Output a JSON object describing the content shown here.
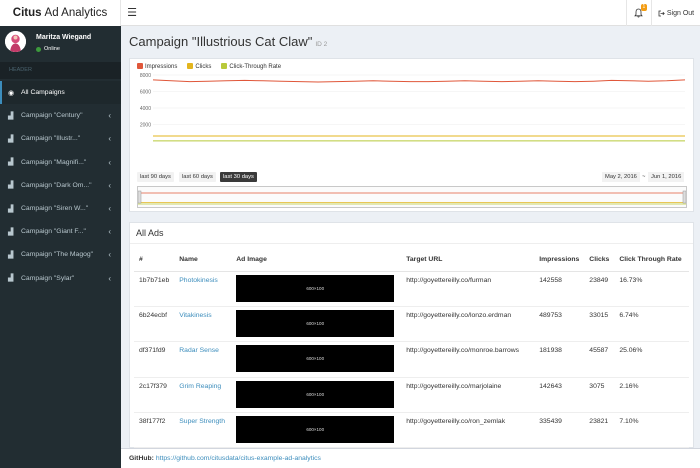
{
  "app": {
    "logo_bold": "Citus",
    "logo_light": "Ad Analytics",
    "menu_toggle_icon": "hamburger-icon",
    "notifications_count": "1",
    "signout_label": "Sign Out"
  },
  "user": {
    "name": "Maritza Wiegand",
    "status": "Online"
  },
  "sidebar": {
    "header": "HEADER",
    "items": [
      {
        "label": "All Campaigns",
        "icon": "circle-icon",
        "active": true
      },
      {
        "label": "Campaign \"Century\"",
        "icon": "bar-chart-icon"
      },
      {
        "label": "Campaign \"Illustr...\"",
        "icon": "bar-chart-icon"
      },
      {
        "label": "Campaign \"Magnifi...\"",
        "icon": "bar-chart-icon"
      },
      {
        "label": "Campaign \"Dark Om...\"",
        "icon": "bar-chart-icon"
      },
      {
        "label": "Campaign \"Siren W...\"",
        "icon": "bar-chart-icon"
      },
      {
        "label": "Campaign \"Giant F...\"",
        "icon": "bar-chart-icon"
      },
      {
        "label": "Campaign \"The Magog\"",
        "icon": "bar-chart-icon"
      },
      {
        "label": "Campaign \"Sylar\"",
        "icon": "bar-chart-icon"
      }
    ]
  },
  "main": {
    "title": "Campaign \"Illustrious Cat Claw\"",
    "title_id": "ID 2",
    "range_buttons": [
      "last 90 days",
      "last 60 days",
      "last 30 days"
    ],
    "range_selected": 2,
    "date_from": "May 2, 2016",
    "date_sep": "~",
    "date_to": "Jun 1, 2016"
  },
  "chart_data": {
    "type": "line",
    "legend": [
      {
        "name": "Impressions",
        "color": "#e0573a"
      },
      {
        "name": "Clicks",
        "color": "#e3b51e"
      },
      {
        "name": "Click-Through Rate",
        "color": "#b8c93a"
      }
    ],
    "y_ticks": [
      "8000",
      "6000",
      "4000",
      "2000"
    ],
    "ylim": [
      0,
      8000
    ],
    "series": [
      {
        "name": "Impressions",
        "values": [
          7400,
          7300,
          7200,
          7250,
          7300,
          7350,
          7300,
          7250,
          7200,
          7150,
          7200,
          7250,
          7300,
          7250,
          7200,
          7200,
          7250,
          7300,
          7250,
          7200,
          7250,
          7300,
          7250,
          7200,
          7250,
          7350,
          7300,
          7250,
          7300,
          7400
        ]
      },
      {
        "name": "Clicks",
        "values": [
          600,
          600,
          600,
          600,
          600,
          600,
          600,
          600,
          600,
          600,
          600,
          600,
          600,
          600,
          600,
          600,
          600,
          600,
          600,
          600,
          600,
          600,
          600,
          600,
          600,
          600,
          600,
          600,
          600,
          600
        ]
      },
      {
        "name": "Click-Through Rate",
        "values": [
          10,
          10,
          10,
          10,
          10,
          10,
          10,
          10,
          10,
          10,
          10,
          10,
          10,
          10,
          10,
          10,
          10,
          10,
          10,
          10,
          10,
          10,
          10,
          10,
          10,
          10,
          10,
          10,
          10,
          10
        ]
      }
    ]
  },
  "ads": {
    "title": "All Ads",
    "columns": [
      "#",
      "Name",
      "Ad Image",
      "Target URL",
      "Impressions",
      "Clicks",
      "Click Through Rate"
    ],
    "image_placeholder": "600×100",
    "rows": [
      {
        "id": "1b7b71eb",
        "name": "Photokinesis",
        "url": "http://goyettereilly.co/furman",
        "impressions": "142558",
        "clicks": "23849",
        "ctr": "16.73%"
      },
      {
        "id": "6b24ecbf",
        "name": "Vitakinesis",
        "url": "http://goyettereilly.co/lonzo.erdman",
        "impressions": "489753",
        "clicks": "33015",
        "ctr": "6.74%"
      },
      {
        "id": "df371fd9",
        "name": "Radar Sense",
        "url": "http://goyettereilly.co/monroe.barrows",
        "impressions": "181938",
        "clicks": "45587",
        "ctr": "25.06%"
      },
      {
        "id": "2c17f379",
        "name": "Grim Reaping",
        "url": "http://goyettereilly.co/marjolaine",
        "impressions": "142643",
        "clicks": "3075",
        "ctr": "2.16%"
      },
      {
        "id": "38f177f2",
        "name": "Super Strength",
        "url": "http://goyettereilly.co/ron_zemlak",
        "impressions": "335439",
        "clicks": "23821",
        "ctr": "7.10%"
      }
    ]
  },
  "footer": {
    "label": "GitHub:",
    "link": "https://github.com/citusdata/citus-example-ad-analytics"
  }
}
